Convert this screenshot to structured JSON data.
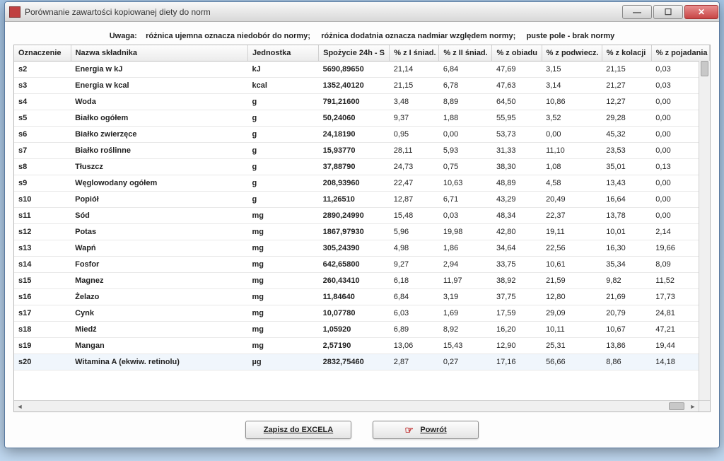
{
  "window": {
    "title": "Porównanie zawartości kopiowanej diety  do norm"
  },
  "notice": {
    "label": "Uwaga:",
    "part1": "różnica ujemna oznacza niedobór do normy;",
    "part2": "różnica dodatnia oznacza nadmiar względem normy;",
    "part3": "puste pole - brak normy"
  },
  "columns": [
    "Oznaczenie",
    "Nazwa składnika",
    "Jednostka",
    "Spożycie 24h - S",
    "% z I śniad.",
    "% z II śniad.",
    "% z obiadu",
    "% z podwiecz.",
    "% z kolacji",
    "% z pojadania"
  ],
  "rows": [
    {
      "id": "s2",
      "name": "Energia w kJ",
      "unit": "kJ",
      "v": "5690,89650",
      "p": [
        "21,14",
        "6,84",
        "47,69",
        "3,15",
        "21,15",
        "0,03"
      ]
    },
    {
      "id": "s3",
      "name": "Energia w kcal",
      "unit": "kcal",
      "v": "1352,40120",
      "p": [
        "21,15",
        "6,78",
        "47,63",
        "3,14",
        "21,27",
        "0,03"
      ]
    },
    {
      "id": "s4",
      "name": "Woda",
      "unit": "g",
      "v": "791,21600",
      "p": [
        "3,48",
        "8,89",
        "64,50",
        "10,86",
        "12,27",
        "0,00"
      ]
    },
    {
      "id": "s5",
      "name": "Białko ogółem",
      "unit": "g",
      "v": "50,24060",
      "p": [
        "9,37",
        "1,88",
        "55,95",
        "3,52",
        "29,28",
        "0,00"
      ]
    },
    {
      "id": "s6",
      "name": "Białko zwierzęce",
      "unit": "g",
      "v": "24,18190",
      "p": [
        "0,95",
        "0,00",
        "53,73",
        "0,00",
        "45,32",
        "0,00"
      ]
    },
    {
      "id": "s7",
      "name": "Białko roślinne",
      "unit": "g",
      "v": "15,93770",
      "p": [
        "28,11",
        "5,93",
        "31,33",
        "11,10",
        "23,53",
        "0,00"
      ]
    },
    {
      "id": "s8",
      "name": "Tłuszcz",
      "unit": "g",
      "v": "37,88790",
      "p": [
        "24,73",
        "0,75",
        "38,30",
        "1,08",
        "35,01",
        "0,13"
      ]
    },
    {
      "id": "s9",
      "name": "Węglowodany ogółem",
      "unit": "g",
      "v": "208,93960",
      "p": [
        "22,47",
        "10,63",
        "48,89",
        "4,58",
        "13,43",
        "0,00"
      ]
    },
    {
      "id": "s10",
      "name": "Popiół",
      "unit": "g",
      "v": "11,26510",
      "p": [
        "12,87",
        "6,71",
        "43,29",
        "20,49",
        "16,64",
        "0,00"
      ]
    },
    {
      "id": "s11",
      "name": "Sód",
      "unit": "mg",
      "v": "2890,24990",
      "p": [
        "15,48",
        "0,03",
        "48,34",
        "22,37",
        "13,78",
        "0,00"
      ]
    },
    {
      "id": "s12",
      "name": "Potas",
      "unit": "mg",
      "v": "1867,97930",
      "p": [
        "5,96",
        "19,98",
        "42,80",
        "19,11",
        "10,01",
        "2,14"
      ]
    },
    {
      "id": "s13",
      "name": "Wapń",
      "unit": "mg",
      "v": "305,24390",
      "p": [
        "4,98",
        "1,86",
        "34,64",
        "22,56",
        "16,30",
        "19,66"
      ]
    },
    {
      "id": "s14",
      "name": "Fosfor",
      "unit": "mg",
      "v": "642,65800",
      "p": [
        "9,27",
        "2,94",
        "33,75",
        "10,61",
        "35,34",
        "8,09"
      ]
    },
    {
      "id": "s15",
      "name": "Magnez",
      "unit": "mg",
      "v": "260,43410",
      "p": [
        "6,18",
        "11,97",
        "38,92",
        "21,59",
        "9,82",
        "11,52"
      ]
    },
    {
      "id": "s16",
      "name": "Żelazo",
      "unit": "mg",
      "v": "11,84640",
      "p": [
        "6,84",
        "3,19",
        "37,75",
        "12,80",
        "21,69",
        "17,73"
      ]
    },
    {
      "id": "s17",
      "name": "Cynk",
      "unit": "mg",
      "v": "10,07780",
      "p": [
        "6,03",
        "1,69",
        "17,59",
        "29,09",
        "20,79",
        "24,81"
      ]
    },
    {
      "id": "s18",
      "name": "Miedź",
      "unit": "mg",
      "v": "1,05920",
      "p": [
        "6,89",
        "8,92",
        "16,20",
        "10,11",
        "10,67",
        "47,21"
      ]
    },
    {
      "id": "s19",
      "name": "Mangan",
      "unit": "mg",
      "v": "2,57190",
      "p": [
        "13,06",
        "15,43",
        "12,90",
        "25,31",
        "13,86",
        "19,44"
      ]
    },
    {
      "id": "s20",
      "name": "Witamina A (ekwiw. retinolu)",
      "unit": "µg",
      "v": "2832,75460",
      "p": [
        "2,87",
        "0,27",
        "17,16",
        "56,66",
        "8,86",
        "14,18"
      ]
    }
  ],
  "buttons": {
    "excel": "Zapisz do EXCELA",
    "back": "Powrót"
  }
}
